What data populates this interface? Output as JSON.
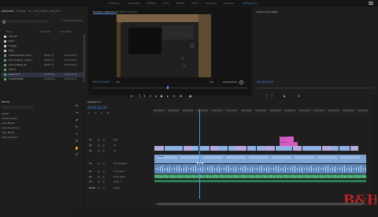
{
  "app": {
    "workspaces": [
      "Learning",
      "Assembly",
      "Editing",
      "Color",
      "Effects",
      "Audio",
      "Graphics",
      "Libraries"
    ],
    "workspace_active": "Editing (CC)",
    "menu_icon": "menu-icon"
  },
  "project": {
    "tabs": [
      "Metadata",
      "Bin: Footage",
      "Bin: G30_FX3",
      "Bin: G30_FX3"
    ],
    "search_info": "1 of 18 items Selected",
    "columns": [
      "Name",
      "Frame Rate",
      "Media Start"
    ],
    "rows": [
      {
        "name": "G30_FX3",
        "fps": "",
        "start": "",
        "sel": false
      },
      {
        "name": "B-Roll",
        "fps": "",
        "start": "",
        "sel": false
      },
      {
        "name": "Footage",
        "fps": "",
        "start": "",
        "sel": false
      },
      {
        "name": "Music",
        "fps": "",
        "start": "",
        "sel": false
      },
      {
        "name": "Untitled Session 1 Mix 7",
        "fps": "48000 Hz",
        "start": "00:00:00:00",
        "sel": false
      },
      {
        "name": "Are You Ready - Audio_1",
        "fps": "48000 Hz",
        "start": "00:00:00:00",
        "sel": false
      },
      {
        "name": "Are You Ready_alt",
        "fps": "48000 Hz",
        "start": "00:00:00:00",
        "sel": false
      },
      {
        "name": "Track 1",
        "fps": "",
        "start": "",
        "sel": false
      },
      {
        "name": "Sequence 1",
        "fps": "23.976 fps",
        "start": "00:00:00:00",
        "sel": true
      },
      {
        "name": "C3364F10.MXF",
        "fps": "23.976 fps",
        "start": "00:00:00:00",
        "sel": false
      }
    ]
  },
  "program": {
    "tab_label": "Program: Sequence 1",
    "tab2_label": "Effect Controls",
    "timecode": "00;01;24;20",
    "fit": "Fit",
    "fraction": "1/2",
    "duration": "00;04;00;21"
  },
  "source": {
    "tab_label": "Source: (no clips)",
    "timecode": "00;00;00;00"
  },
  "effects": {
    "title": "Effects",
    "items": [
      "Presets",
      "Lumetri Presets",
      "Audio Effects",
      "Audio Transitions",
      "Video Effects",
      "Video Transitions"
    ]
  },
  "timeline": {
    "tab_label": "Sequence 1",
    "timecode": "00;01;24;20",
    "ruler": [
      "00;00;00;00",
      "00;00;16;00",
      "00;00;32;00",
      "00;00;48;00",
      "00;01;04;02",
      "00;01;20;02",
      "00;01;36;02",
      "00;01;52;02",
      "00;02;08;04",
      "00;02;24;04",
      "00;02;40;04",
      "00;02;56;06",
      "00;03;12;06",
      "00;03;28;06",
      "00;03;44;08"
    ],
    "tracks": [
      {
        "id": "V4",
        "label": "Text"
      },
      {
        "id": "V3",
        "label": "V3"
      },
      {
        "id": "V2",
        "label": "V2"
      },
      {
        "id": "V1",
        "label": "B-roll footage"
      },
      {
        "id": "A1",
        "label": "A-roll audio"
      },
      {
        "id": "A2",
        "label": "Music Track"
      },
      {
        "id": "A3",
        "label": "Audio 3"
      },
      {
        "id": "Master",
        "label": "Master"
      }
    ],
    "clip_labels": {
      "main_clip": "Footage",
      "text1": "Default Te",
      "text2": "Default Te"
    }
  },
  "brand": {
    "logo_text": "B&H"
  }
}
